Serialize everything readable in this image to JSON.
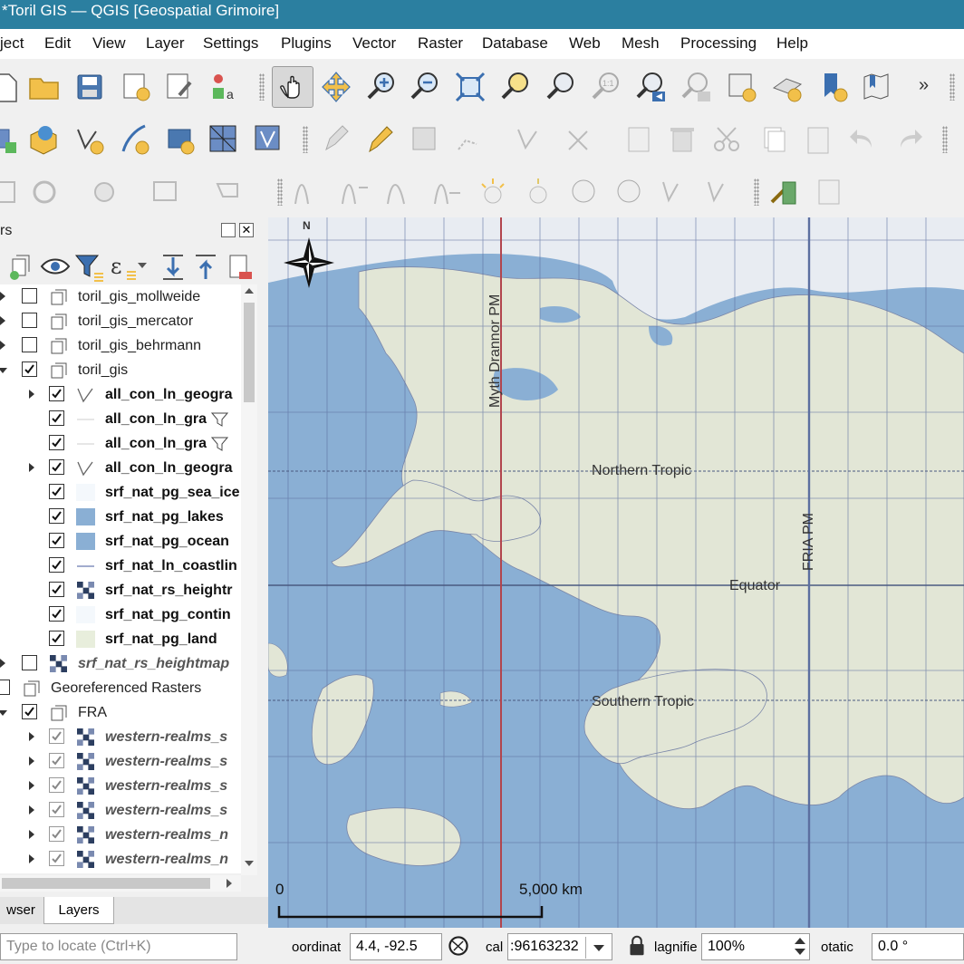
{
  "window": {
    "title": "*Toril GIS — QGIS [Geospatial Grimoire]"
  },
  "menu": [
    "ject",
    "Edit",
    "View",
    "Layer",
    "Settings",
    "Plugins",
    "Vector",
    "Raster",
    "Database",
    "Web",
    "Mesh",
    "Processing",
    "Help"
  ],
  "toolbar": {
    "overflow": "»"
  },
  "panel": {
    "title": "rs"
  },
  "layers": [
    {
      "label": "toril_gis_mollweide"
    },
    {
      "label": "toril_gis_mercator"
    },
    {
      "label": "toril_gis_behrmann"
    },
    {
      "label": "toril_gis"
    },
    {
      "label": "all_con_ln_geogra"
    },
    {
      "label": "all_con_ln_gra"
    },
    {
      "label": "all_con_ln_gra"
    },
    {
      "label": "all_con_ln_geogra"
    },
    {
      "label": "srf_nat_pg_sea_ice"
    },
    {
      "label": "srf_nat_pg_lakes"
    },
    {
      "label": "srf_nat_pg_ocean"
    },
    {
      "label": "srf_nat_ln_coastlin"
    },
    {
      "label": "srf_nat_rs_heightr"
    },
    {
      "label": "srf_nat_pg_contin"
    },
    {
      "label": "srf_nat_pg_land"
    },
    {
      "label": "srf_nat_rs_heightmap"
    },
    {
      "label": "Georeferenced Rasters"
    },
    {
      "label": "FRA"
    },
    {
      "label": "western-realms_s"
    },
    {
      "label": "western-realms_s"
    },
    {
      "label": "western-realms_s"
    },
    {
      "label": "western-realms_s"
    },
    {
      "label": "western-realms_n"
    },
    {
      "label": "western-realms_n"
    }
  ],
  "tabs": {
    "browser": "wser",
    "layers": "Layers"
  },
  "status": {
    "locate_placeholder": "Type to locate (Ctrl+K)",
    "coord_label": "oordinat",
    "coord_value": "4.4, -92.5",
    "scale_label": "cal",
    "scale_value": ":96163232",
    "magnifier_label": "lagnifie",
    "magnifier_value": "100%",
    "rotation_label": "otatic",
    "rotation_value": "0.0 °"
  },
  "map": {
    "north_label": "N",
    "meridians": [
      "Myth Drannor PM",
      "FRIA PM"
    ],
    "parallels": [
      "Northern Tropic",
      "Equator",
      "Southern Tropic"
    ],
    "scalebar": {
      "start": "0",
      "end": "5,000 km"
    }
  },
  "colors": {
    "titlebar": "#2b7fa0",
    "ocean": "#8aafd4",
    "land": "#e2e6d6",
    "ice": "#e8ecf2",
    "meridian_red": "#b2454e",
    "meridian_blue": "#5c6fa0"
  }
}
